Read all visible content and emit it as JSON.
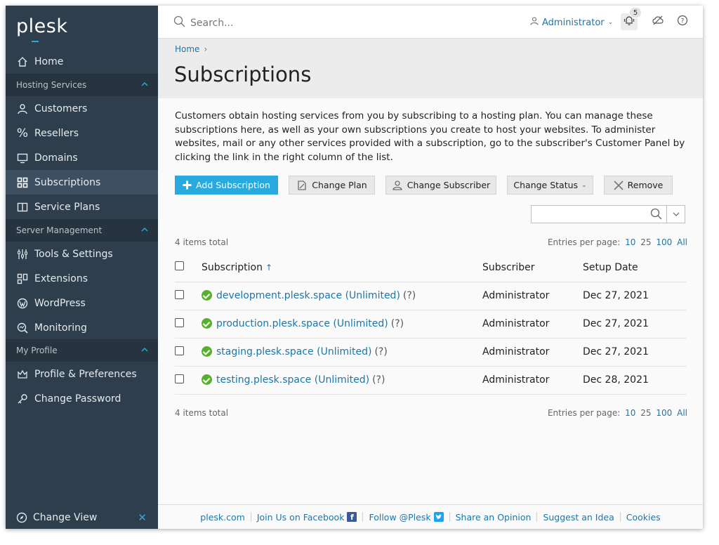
{
  "app": {
    "logo": "plesk"
  },
  "sidebar": {
    "home": "Home",
    "sections": [
      {
        "label": "Hosting Services",
        "items": [
          "Customers",
          "Resellers",
          "Domains",
          "Subscriptions",
          "Service Plans"
        ]
      },
      {
        "label": "Server Management",
        "items": [
          "Tools & Settings",
          "Extensions",
          "WordPress",
          "Monitoring"
        ]
      },
      {
        "label": "My Profile",
        "items": [
          "Profile & Preferences",
          "Change Password"
        ]
      }
    ],
    "active_item": "Subscriptions",
    "change_view": "Change View"
  },
  "topbar": {
    "search_placeholder": "Search...",
    "user": "Administrator",
    "notifications_count": "5"
  },
  "header": {
    "breadcrumb": "Home",
    "title": "Subscriptions"
  },
  "content": {
    "description": "Customers obtain hosting services from you by subscribing to a hosting plan. You can manage these subscriptions here, as well as your own subscriptions you create to host your websites. To administer websites, mail or any other services provided with a subscription, go to the subscriber's Customer Panel by clicking the link in the right column of the list.",
    "buttons": {
      "add": "Add Subscription",
      "change_plan": "Change Plan",
      "change_subscriber": "Change Subscriber",
      "change_status": "Change Status",
      "remove": "Remove"
    },
    "items_total": "4 items total",
    "entries_label": "Entries per page:",
    "entries_options": [
      "10",
      "25",
      "100",
      "All"
    ],
    "columns": [
      "Subscription",
      "Subscriber",
      "Setup Date"
    ],
    "rows": [
      {
        "name": "development.plesk.space (Unlimited)",
        "help": "(?)",
        "subscriber": "Administrator",
        "date": "Dec 27, 2021"
      },
      {
        "name": "production.plesk.space (Unlimited)",
        "help": "(?)",
        "subscriber": "Administrator",
        "date": "Dec 27, 2021"
      },
      {
        "name": "staging.plesk.space (Unlimited)",
        "help": "(?)",
        "subscriber": "Administrator",
        "date": "Dec 27, 2021"
      },
      {
        "name": "testing.plesk.space (Unlimited)",
        "help": "(?)",
        "subscriber": "Administrator",
        "date": "Dec 28, 2021"
      }
    ]
  },
  "footer": {
    "links": [
      "plesk.com",
      "Join Us on Facebook",
      "Follow @Plesk",
      "Share an Opinion",
      "Suggest an Idea",
      "Cookies"
    ]
  },
  "colors": {
    "sidebar": "#2f3e4c",
    "accent": "#28aade",
    "link": "#1d76a8",
    "ok": "#58b12d"
  }
}
